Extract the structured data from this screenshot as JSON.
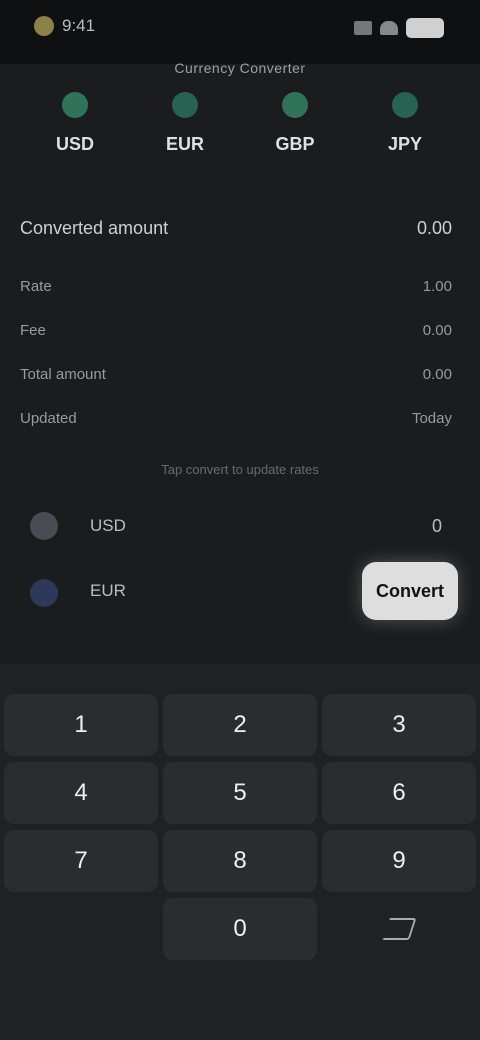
{
  "status": {
    "time": "9:41"
  },
  "title": "Currency Converter",
  "currency_tabs": [
    {
      "code": "USD"
    },
    {
      "code": "EUR"
    },
    {
      "code": "GBP"
    },
    {
      "code": "JPY"
    }
  ],
  "result": {
    "title": "Converted amount",
    "value": "0.00",
    "rows": [
      {
        "label": "Rate",
        "value": "1.00"
      },
      {
        "label": "Fee",
        "value": "0.00"
      },
      {
        "label": "Total amount",
        "value": "0.00"
      },
      {
        "label": "Updated",
        "value": "Today"
      }
    ]
  },
  "rate_note": "Tap convert to update rates",
  "inputs": {
    "from": {
      "code": "USD",
      "amount": "0"
    },
    "to": {
      "code": "EUR",
      "amount": ""
    }
  },
  "buttons": {
    "convert": "Convert"
  },
  "keypad": {
    "keys": [
      "1",
      "2",
      "3",
      "4",
      "5",
      "6",
      "7",
      "8",
      "9",
      "",
      "0",
      ""
    ]
  }
}
